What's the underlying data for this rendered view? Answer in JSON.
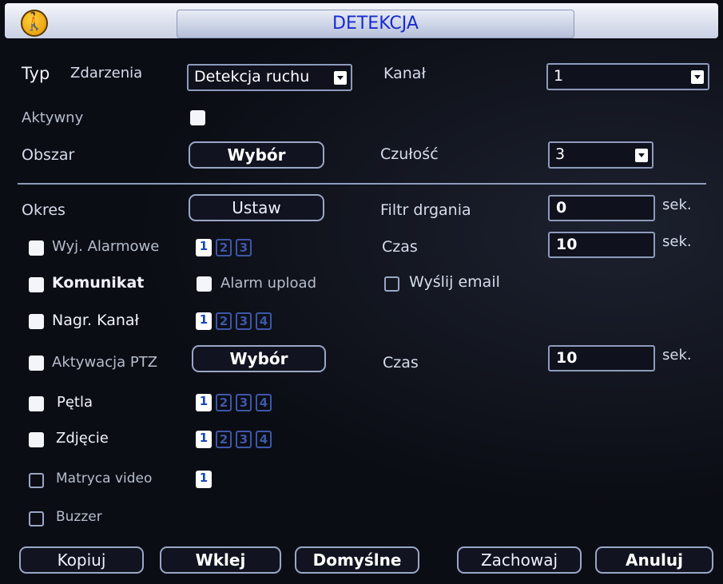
{
  "title": "DETEKCJA",
  "icons": {
    "app_icon": "walking-person-icon"
  },
  "colors": {
    "title_text": "#1a2ad0",
    "background": "#0b0d14",
    "channel_active": "#ffffff",
    "channel_inactive": "#3d57a8"
  },
  "event_type": {
    "label_bold": "Typ",
    "label": "Zdarzenia",
    "value": "Detekcja ruchu"
  },
  "channel": {
    "label": "Kanał",
    "value": "1"
  },
  "active": {
    "label": "Aktywny",
    "checked": true
  },
  "area": {
    "label": "Obszar",
    "button": "Wybór"
  },
  "sensitivity": {
    "label": "Czułość",
    "value": "3"
  },
  "period": {
    "label": "Okres",
    "button": "Ustaw"
  },
  "anti_dither": {
    "label": "Filtr drgania",
    "value": "0",
    "unit": "sek."
  },
  "alarm_out": {
    "label": "Wyj. Alarmowe",
    "checked": true,
    "channels": [
      "1",
      "2",
      "3"
    ],
    "active_channels": [
      "1"
    ]
  },
  "delay": {
    "label": "Czas",
    "value": "10",
    "unit": "sek."
  },
  "message": {
    "label": "Komunikat",
    "checked": true
  },
  "alarm_upload": {
    "label": "Alarm upload",
    "checked": true
  },
  "send_email": {
    "label": "Wyślij email",
    "checked": false
  },
  "record_channel": {
    "label": "Nagr. Kanał",
    "checked": true,
    "channels": [
      "1",
      "2",
      "3",
      "4"
    ],
    "active_channels": [
      "1"
    ]
  },
  "ptz": {
    "label": "Aktywacja PTZ",
    "checked": true,
    "button": "Wybór"
  },
  "ptz_delay": {
    "label": "Czas",
    "value": "10",
    "unit": "sek."
  },
  "tour": {
    "label": "Pętla",
    "checked": true,
    "channels": [
      "1",
      "2",
      "3",
      "4"
    ],
    "active_channels": [
      "1"
    ]
  },
  "snapshot": {
    "label": "Zdjęcie",
    "checked": true,
    "channels": [
      "1",
      "2",
      "3",
      "4"
    ],
    "active_channels": [
      "1"
    ]
  },
  "matrix": {
    "label": "Matryca video",
    "checked": false,
    "channels": [
      "1"
    ],
    "active_channels": [
      "1"
    ]
  },
  "buzzer": {
    "label": "Buzzer",
    "checked": false
  },
  "footer": {
    "copy": "Kopiuj",
    "paste": "Wklej",
    "default": "Domyślne",
    "save": "Zachowaj",
    "cancel": "Anuluj"
  }
}
